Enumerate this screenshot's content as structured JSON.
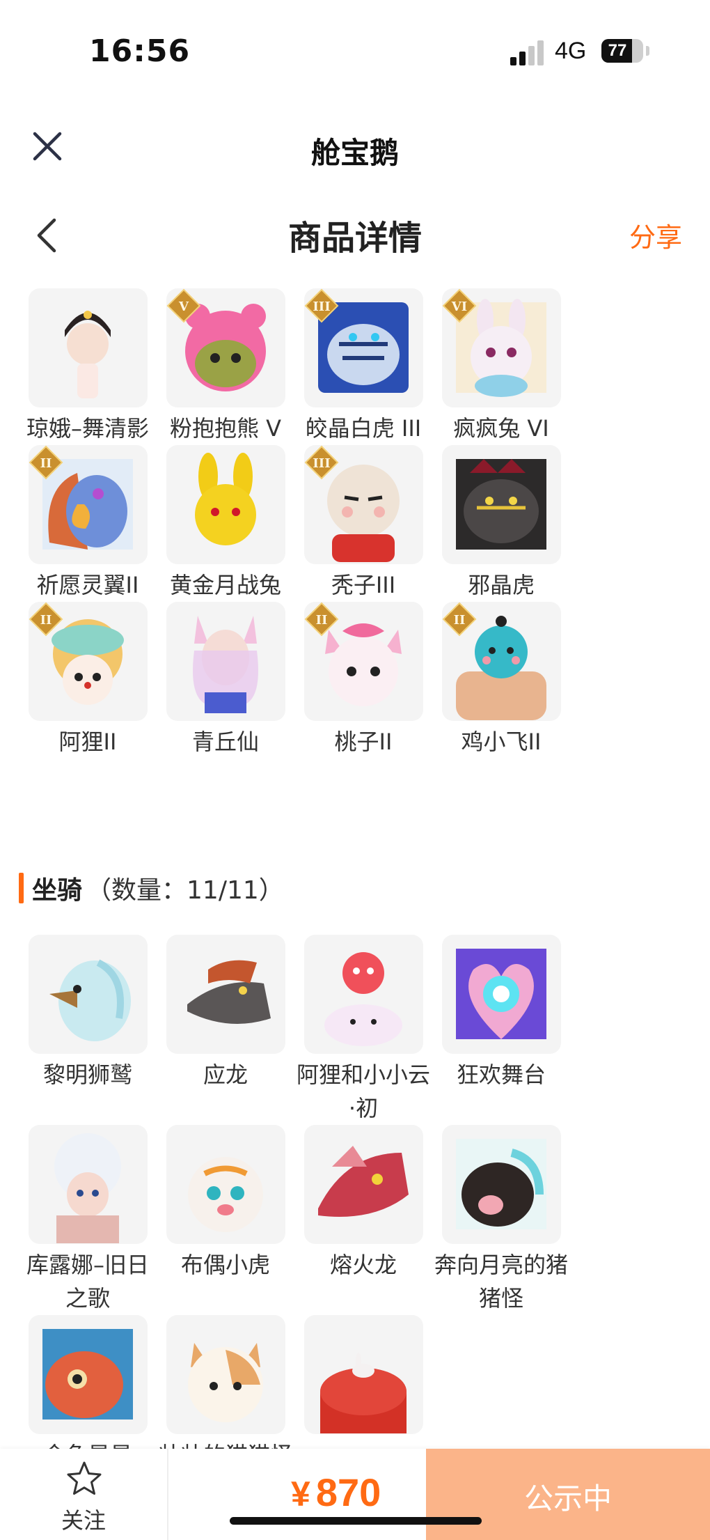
{
  "status_bar": {
    "time": "16:56",
    "network": "4G",
    "battery": "77"
  },
  "app": {
    "title": "舱宝鹅"
  },
  "page": {
    "title": "商品详情",
    "share": "分享"
  },
  "skins": [
    {
      "name": "琼娥–舞清影",
      "icon": "qiong-e-avatar",
      "badge": ""
    },
    {
      "name": "粉抱抱熊 V",
      "icon": "pink-bear-avatar",
      "badge": "V"
    },
    {
      "name": "皎晶白虎 III",
      "icon": "white-tiger-avatar",
      "badge": "III"
    },
    {
      "name": "疯疯兔 VI",
      "icon": "crazy-rabbit-avatar",
      "badge": "VI"
    },
    {
      "name": "祈愿灵翼II",
      "icon": "spirit-wing-avatar",
      "badge": "II"
    },
    {
      "name": "黄金月战兔",
      "icon": "golden-rabbit-avatar",
      "badge": ""
    },
    {
      "name": "秃子III",
      "icon": "bald-avatar",
      "badge": "III"
    },
    {
      "name": "邪晶虎",
      "icon": "evil-tiger-avatar",
      "badge": ""
    },
    {
      "name": "阿狸II",
      "icon": "ali-avatar",
      "badge": "II"
    },
    {
      "name": "青丘仙",
      "icon": "fox-fairy-avatar",
      "badge": ""
    },
    {
      "name": "桃子II",
      "icon": "peach-cat-avatar",
      "badge": "II"
    },
    {
      "name": "鸡小飞II",
      "icon": "chicken-avatar",
      "badge": "II"
    }
  ],
  "mounts_section": {
    "title": "坐骑",
    "count": "（数量：11/11）"
  },
  "mounts": [
    {
      "name": "黎明狮鹫",
      "icon": "griffin-mount"
    },
    {
      "name": "应龙",
      "icon": "dragon-mount"
    },
    {
      "name": "阿狸和小小云·初",
      "icon": "ali-cloud-mount"
    },
    {
      "name": "狂欢舞台",
      "icon": "stage-mount"
    },
    {
      "name": "库露娜–旧日之歌",
      "icon": "kuluna-mount"
    },
    {
      "name": "布偶小虎",
      "icon": "tiger-doll-mount"
    },
    {
      "name": "熔火龙",
      "icon": "lava-dragon-mount"
    },
    {
      "name": "奔向月亮的猪猪怪",
      "icon": "pig-mount"
    },
    {
      "name": "金鱼昊昊",
      "icon": "goldfish-mount"
    },
    {
      "name": "壮壮的猫猫怪",
      "icon": "cat-mount"
    },
    {
      "name": "",
      "icon": "drum-mount"
    }
  ],
  "bottom": {
    "follow": "关注",
    "currency": "¥",
    "price": "870",
    "status": "公示中"
  },
  "colors": {
    "accent": "#ff6a13",
    "status_button": "#fbb489",
    "tile_bg": "#f4f4f4"
  }
}
